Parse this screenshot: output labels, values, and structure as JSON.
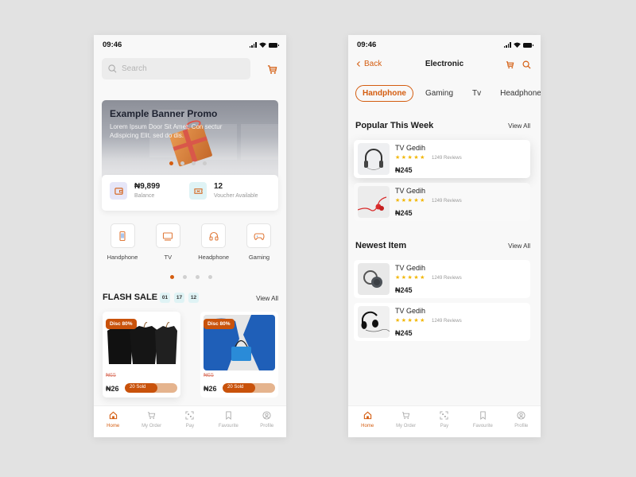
{
  "colors": {
    "accent": "#d45d10",
    "text": "#1a1a1a",
    "muted": "#999999",
    "background": "#e2e2e2"
  },
  "home": {
    "status": {
      "time": "09:46"
    },
    "search": {
      "placeholder": "Search"
    },
    "banner": {
      "title": "Example Banner Promo",
      "subtitle": "Lorem Ipsum Door Sit Amet, Con sectur Adispicing Elit. sed do dis.",
      "slides": 4,
      "active_slide": 1
    },
    "wallet": {
      "balance_value": "₦9,899",
      "balance_label": "Balance",
      "voucher_value": "12",
      "voucher_label": "Voucher Available"
    },
    "categories": [
      {
        "label": "Handphone",
        "icon": "phone-icon"
      },
      {
        "label": "TV",
        "icon": "tv-icon"
      },
      {
        "label": "Headphone",
        "icon": "headphone-icon"
      },
      {
        "label": "Gaming",
        "icon": "gamepad-icon"
      }
    ],
    "category_pages": 4,
    "category_active_page": 1,
    "flash_sale": {
      "title": "FLASH SALE",
      "timer": [
        "01",
        "17",
        "12"
      ],
      "view_all": "View All",
      "items": [
        {
          "discount": "Disc 80%",
          "old_price": "₦65",
          "price": "₦26",
          "sold_label": "20 Sold",
          "sold_fraction": 0.62,
          "image": "black-tshirts"
        },
        {
          "discount": "Disc 80%",
          "old_price": "₦65",
          "price": "₦26",
          "sold_label": "20 Sold",
          "sold_fraction": 0.62,
          "image": "blue-bag"
        }
      ]
    },
    "tabbar": [
      {
        "label": "Home",
        "icon": "home-icon",
        "active": true
      },
      {
        "label": "My Order",
        "icon": "cart-icon",
        "active": false
      },
      {
        "label": "Pay",
        "icon": "scan-icon",
        "active": false
      },
      {
        "label": "Favourite",
        "icon": "bookmark-icon",
        "active": false
      },
      {
        "label": "Profile",
        "icon": "profile-icon",
        "active": false
      }
    ]
  },
  "electronic": {
    "status": {
      "time": "09:46"
    },
    "nav": {
      "back": "Back",
      "title": "Electronic"
    },
    "chips": [
      {
        "label": "Handphone",
        "active": true
      },
      {
        "label": "Gaming",
        "active": false
      },
      {
        "label": "Tv",
        "active": false
      },
      {
        "label": "Headphone",
        "active": false
      }
    ],
    "popular": {
      "title": "Popular This Week",
      "view_all": "View All",
      "items": [
        {
          "name": "TV Gedih",
          "rating": 5,
          "stars": "★★★★★",
          "reviews": "1249 Reviews",
          "price": "₦245"
        },
        {
          "name": "TV Gedih",
          "rating": 5,
          "stars": "★★★★★",
          "reviews": "1249 Reviews",
          "price": "₦245"
        }
      ]
    },
    "newest": {
      "title": "Newest Item",
      "view_all": "View All",
      "items": [
        {
          "name": "TV Gedih",
          "rating": 5,
          "stars": "★★★★★",
          "reviews": "1249 Reviews",
          "price": "₦245"
        },
        {
          "name": "TV Gedih",
          "rating": 5,
          "stars": "★★★★★",
          "reviews": "1249 Reviews",
          "price": "₦245"
        }
      ]
    },
    "tabbar": [
      {
        "label": "Home",
        "icon": "home-icon",
        "active": true
      },
      {
        "label": "My Order",
        "icon": "cart-icon",
        "active": false
      },
      {
        "label": "Pay",
        "icon": "scan-icon",
        "active": false
      },
      {
        "label": "Favourite",
        "icon": "bookmark-icon",
        "active": false
      },
      {
        "label": "Profile",
        "icon": "profile-icon",
        "active": false
      }
    ]
  }
}
